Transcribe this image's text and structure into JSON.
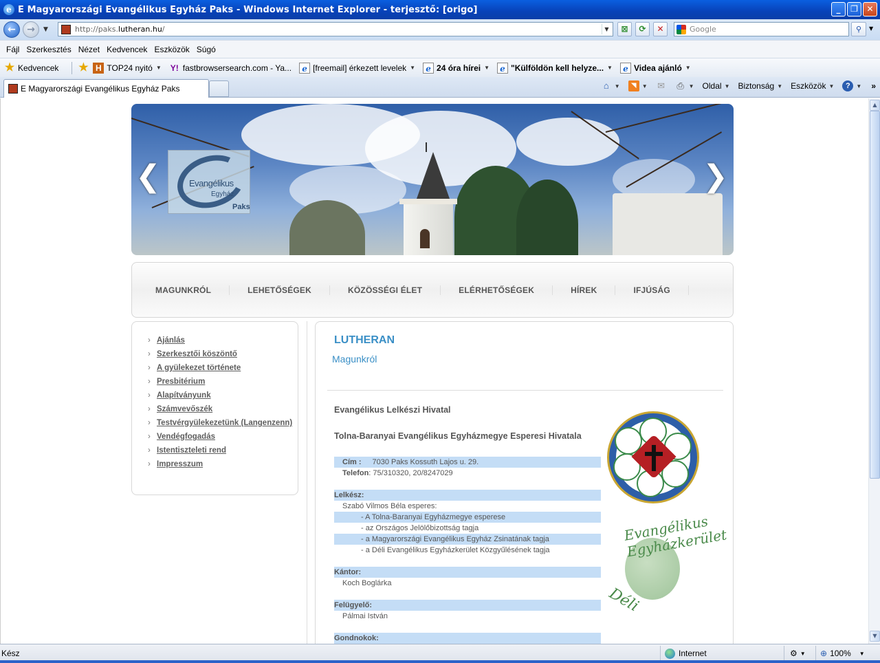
{
  "window": {
    "title": "E Magyarországi Evangélikus Egyház Paks - Windows Internet Explorer - terjesztő: [origo]",
    "icon": "ie-icon"
  },
  "address": {
    "url_prefix": "http://paks.",
    "url_domain": "lutheran.hu",
    "url_suffix": "/",
    "search_placeholder": "Google"
  },
  "menu": [
    "Fájl",
    "Szerkesztés",
    "Nézet",
    "Kedvencek",
    "Eszközök",
    "Súgó"
  ],
  "favorites": {
    "label": "Kedvencek",
    "items": [
      {
        "label": "TOP24 nyitó",
        "icon": "h-icon"
      },
      {
        "label": "fastbrowsersearch.com - Ya...",
        "icon": "yahoo-icon"
      },
      {
        "label": "[freemail] érkezett levelek",
        "icon": "ie-page-icon"
      },
      {
        "label": "24 óra hírei",
        "icon": "ie-page-icon"
      },
      {
        "label": "\"Külföldön kell helyze...",
        "icon": "ie-page-icon"
      },
      {
        "label": "Videa ajánló",
        "icon": "ie-page-icon"
      }
    ]
  },
  "tab": {
    "title": "E Magyarországi Evangélikus Egyház Paks"
  },
  "commandbar": {
    "page": "Oldal",
    "safety": "Biztonság",
    "tools": "Eszközök"
  },
  "status": {
    "text": "Kész",
    "zone": "Internet",
    "zoom": "100%"
  },
  "page": {
    "logo": {
      "line1": "Evangélikus",
      "line2": "Egyház",
      "line3": "Paks"
    },
    "nav": [
      "MAGUNKRÓL",
      "LEHETŐSÉGEK",
      "KÖZÖSSÉGI ÉLET",
      "ELÉRHETŐSÉGEK",
      "HÍREK",
      "IFJÚSÁG"
    ],
    "sidebar": [
      "Ajánlás",
      "Szerkesztői köszöntő",
      "A gyülekezet története",
      "Presbitérium",
      "Alapítványunk",
      "Számvevőszék",
      "Testvérgyülekezetünk (Langenzenn)",
      "Vendégfogadás",
      "Istentiszteleti rend",
      "Impresszum"
    ],
    "main": {
      "heading": "LUTHERAN",
      "subheading": "Magunkról",
      "office1": "Evangélikus Lelkészi Hivatal",
      "office2": "Tolna-Baranyai Evangélikus Egyházmegye Esperesi Hivatala",
      "address_label": "Cím :",
      "address_value": "7030 Paks Kossuth Lajos u. 29.",
      "phone_label": "Telefon",
      "phone_value": ": 75/310320, 20/8247029",
      "pastor_label": "Lelkész:",
      "pastor_name": "Szabó Vilmos Béla esperes:",
      "pastor_roles": [
        "- A Tolna-Baranyai Egyházmegye esperese",
        "- az Országos Jelölőbizottság tagja",
        "- a Magyarországi Evangélikus Egyház Zsinatának tagja",
        "- a Déli Evangélikus Egyházkerület Közgyűlésének tagja"
      ],
      "cantor_label": "Kántor:",
      "cantor_name": "Koch Boglárka",
      "supervisor_label": "Felügyelő:",
      "supervisor_name": "Pálmai István",
      "wardens_label": "Gondnokok:",
      "deli_logo_top": "Evangélikus Egyházkerület",
      "deli_logo_bottom": "Déli"
    }
  }
}
